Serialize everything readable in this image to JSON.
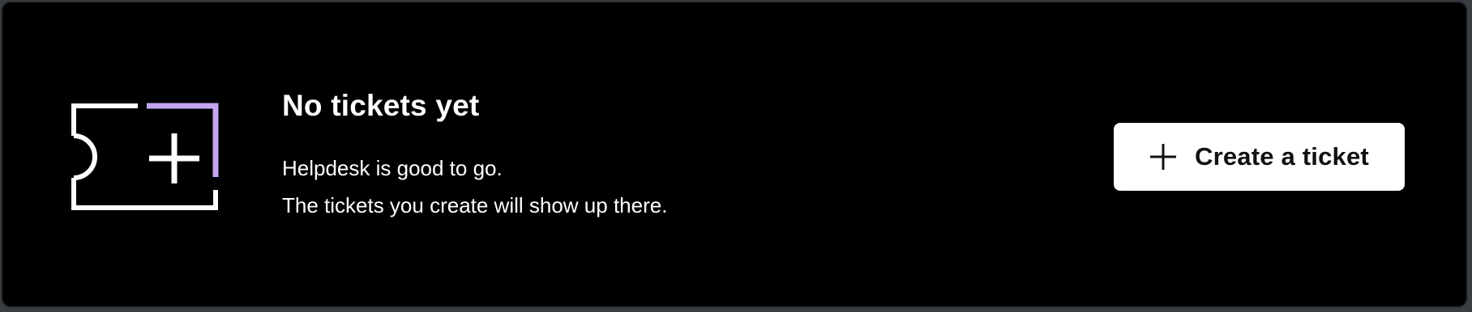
{
  "empty_state": {
    "icon": "ticket-plus-icon",
    "title": "No tickets yet",
    "description_line1": "Helpdesk is good to go.",
    "description_line2": "The tickets you create will show up there."
  },
  "actions": {
    "create_icon": "plus-icon",
    "create_label": "Create a ticket"
  },
  "colors": {
    "background": "#000000",
    "text": "#ffffff",
    "accent": "#c4a6f0",
    "button_background": "#ffffff",
    "button_text": "#111111"
  }
}
